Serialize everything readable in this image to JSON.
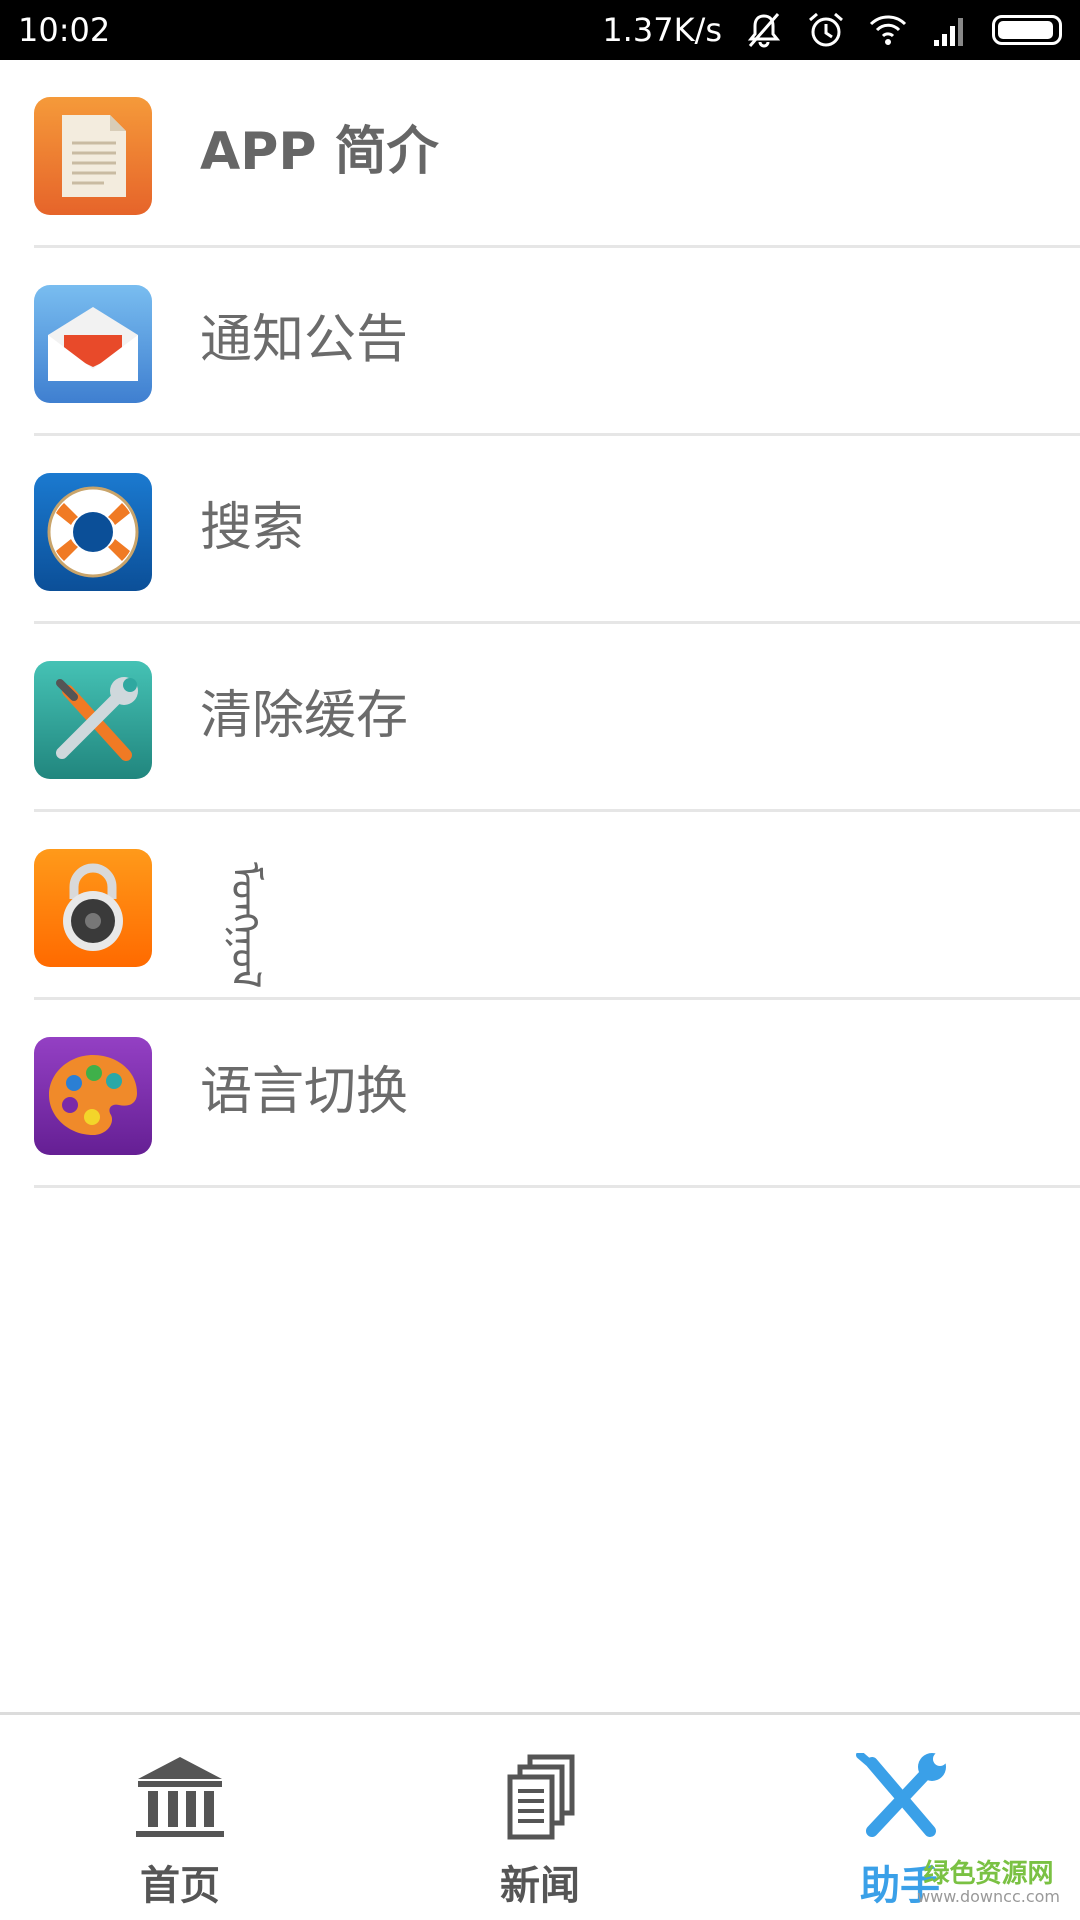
{
  "status_bar": {
    "time": "10:02",
    "network_speed": "1.37K/s",
    "icons": [
      "mute-icon",
      "alarm-icon",
      "wifi-icon",
      "signal-icon",
      "battery-icon"
    ],
    "battery_level": 0.95
  },
  "menu": {
    "items": [
      {
        "label": "APP 简介",
        "icon": "document-icon",
        "icon_color": "#ef7f2b"
      },
      {
        "label": "通知公告",
        "icon": "mail-icon",
        "icon_color": "#4a90d9"
      },
      {
        "label": "搜索",
        "icon": "lifebuoy-icon",
        "icon_color": "#1566b8"
      },
      {
        "label": "清除缓存",
        "icon": "tools-icon",
        "icon_color": "#2fa8a0"
      },
      {
        "label": "ᠮᠣᠩᠭᠣᠯ",
        "icon": "lock-icon",
        "icon_color": "#ff7a00"
      },
      {
        "label": "语言切换",
        "icon": "palette-icon",
        "icon_color": "#7a2aa8"
      }
    ]
  },
  "bottom_nav": {
    "items": [
      {
        "label": "首页",
        "icon": "bank-icon",
        "active": false
      },
      {
        "label": "新闻",
        "icon": "news-icon",
        "active": false
      },
      {
        "label": "助手",
        "icon": "tools-icon",
        "active": true
      }
    ],
    "active_color": "#3aa0e8",
    "inactive_color": "#555555"
  },
  "watermark": {
    "title": "绿色资源网",
    "url": "www.downcc.com"
  }
}
